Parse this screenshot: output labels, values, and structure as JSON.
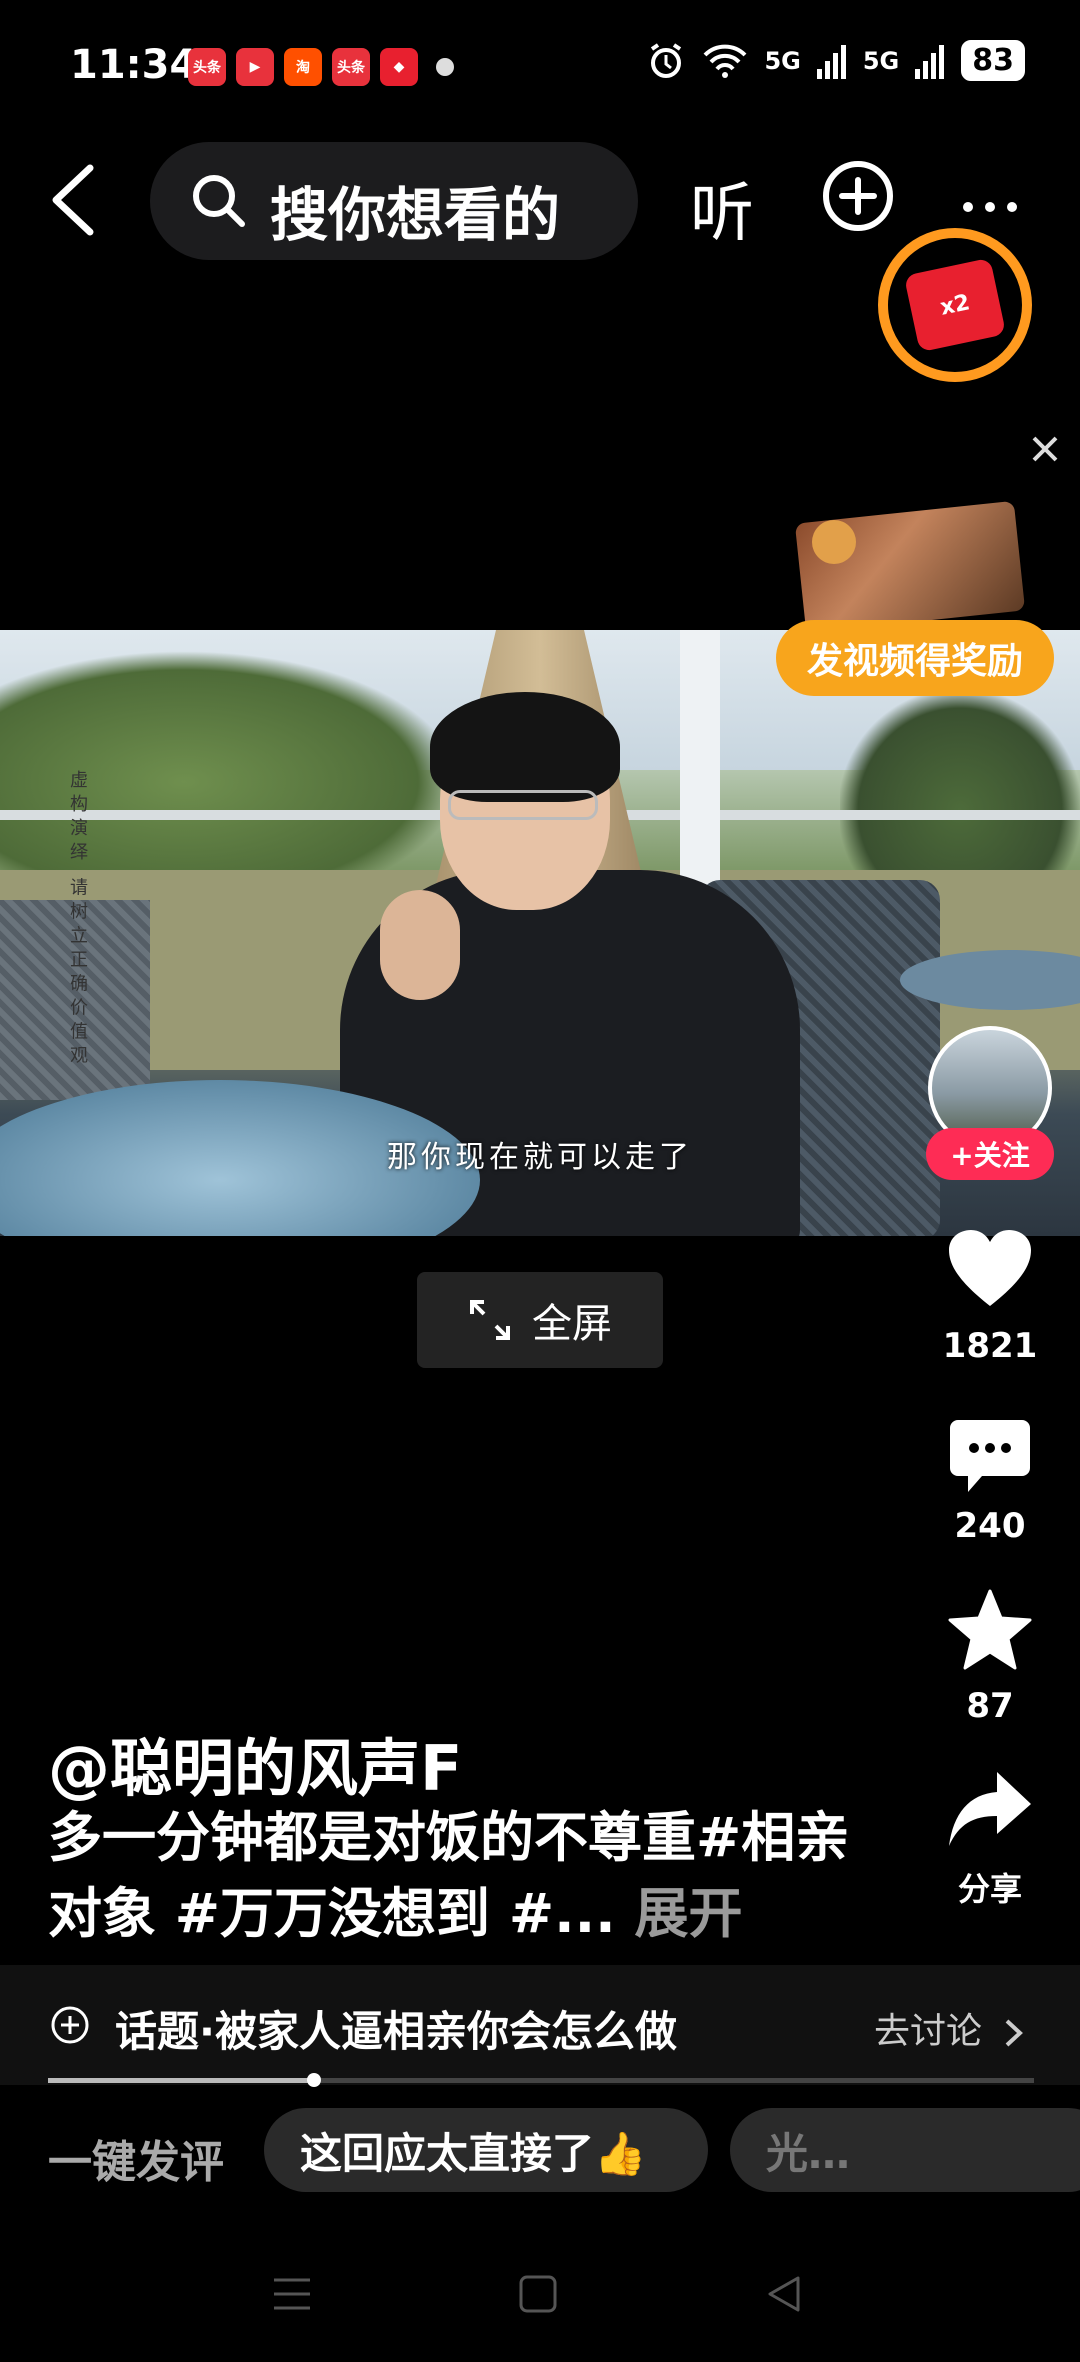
{
  "status_bar": {
    "time": "11:34",
    "app_icons": [
      {
        "name": "toutiao-icon",
        "label": "头条",
        "color": "#e8323c"
      },
      {
        "name": "video-app-icon",
        "label": "▶",
        "color": "#e8323c"
      },
      {
        "name": "taobao-icon",
        "label": "淘",
        "color": "#ff5000"
      },
      {
        "name": "toutiao-icon",
        "label": "头条",
        "color": "#e8323c"
      },
      {
        "name": "app-icon",
        "label": "◆",
        "color": "#e8202f"
      }
    ],
    "signal_1": "5G",
    "signal_2": "5G",
    "battery": "83"
  },
  "top_bar": {
    "search_placeholder": "搜你想看的",
    "listen_label": "听"
  },
  "redpack": {
    "multiplier": "x2"
  },
  "reward": {
    "label": "发视频得奖励"
  },
  "video": {
    "watermark": "虚构演绎 请树立正确价值观",
    "subtitle": "那你现在就可以走了"
  },
  "fullscreen": {
    "label": "全屏"
  },
  "actions": {
    "follow_label": "+关注",
    "likes": "1821",
    "comments": "240",
    "favorites": "87",
    "share_label": "分享"
  },
  "caption": {
    "author": "@聪明的风声F",
    "text": "多一分钟都是对饭的不尊重#相亲对象 #万万没想到 #...",
    "expand_label": "展开"
  },
  "topic": {
    "text": "话题·被家人逼相亲你会怎么做",
    "discuss_label": "去讨论"
  },
  "progress": {
    "played_fraction": 0.27
  },
  "quick_comment": {
    "label": "一键发评",
    "chips": [
      "这回应太直接了👍",
      "光…"
    ]
  },
  "colors": {
    "accent_red": "#fe2c55",
    "reward_orange": "#f8a51c",
    "redpack_ring": "#ff9a1f"
  }
}
